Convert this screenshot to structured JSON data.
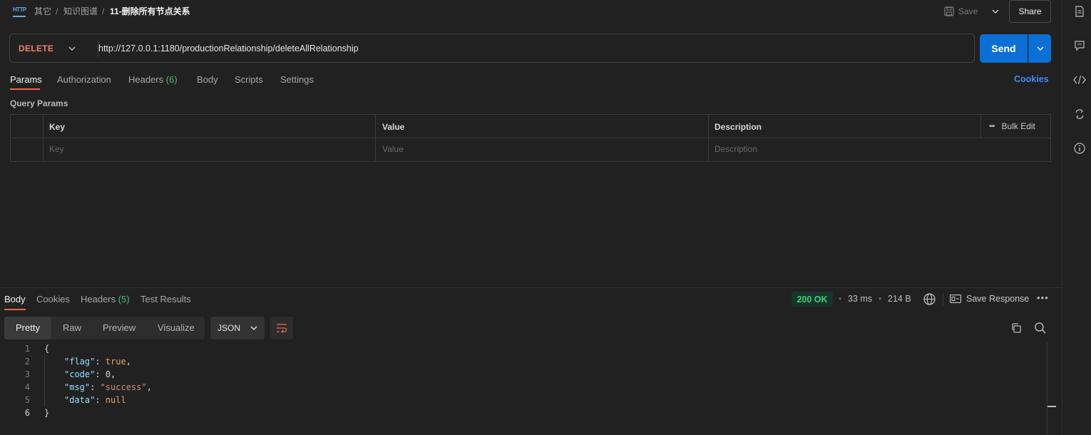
{
  "breadcrumb": {
    "icon": "http-file-icon",
    "icon_text": "HTTP",
    "parts": [
      "其它",
      "知识图谱",
      "11-删除所有节点关系"
    ],
    "separator": "/"
  },
  "header": {
    "save_label": "Save",
    "share_label": "Share"
  },
  "request": {
    "method": "DELETE",
    "method_color": "#e8836a",
    "url": "http://127.0.0.1:1180/productionRelationship/deleteAllRelationship",
    "send_label": "Send"
  },
  "request_tabs": {
    "params": "Params",
    "authorization": "Authorization",
    "headers": "Headers",
    "headers_count": "(6)",
    "body": "Body",
    "scripts": "Scripts",
    "settings": "Settings",
    "active": "Params",
    "cookies": "Cookies"
  },
  "query_params": {
    "title": "Query Params",
    "columns": [
      "Key",
      "Value",
      "Description"
    ],
    "bulk_edit": "Bulk Edit",
    "placeholders": [
      "Key",
      "Value",
      "Description"
    ]
  },
  "response_tabs": {
    "body": "Body",
    "cookies": "Cookies",
    "headers": "Headers",
    "headers_count": "(5)",
    "test_results": "Test Results",
    "active": "Body"
  },
  "response_meta": {
    "status": "200 OK",
    "status_color": "#3ccf7a",
    "time": "33 ms",
    "size": "214 B",
    "save_response": "Save Response"
  },
  "view_modes": [
    "Pretty",
    "Raw",
    "Preview",
    "Visualize"
  ],
  "active_view_mode": "Pretty",
  "format": "JSON",
  "response_body": {
    "line_numbers": [
      "1",
      "2",
      "3",
      "4",
      "5",
      "6"
    ],
    "open_brace": "{",
    "close_brace": "}",
    "fields": [
      {
        "key": "\"flag\"",
        "value": "true",
        "trail": ","
      },
      {
        "key": "\"code\"",
        "value": "0",
        "trail": ","
      },
      {
        "key": "\"msg\"",
        "value": "\"success\"",
        "trail": ","
      },
      {
        "key": "\"data\"",
        "value": "null",
        "trail": ""
      }
    ]
  },
  "side_panel_icons": [
    "document-icon",
    "comment-icon",
    "code-icon",
    "sync-icon",
    "info-icon"
  ],
  "accent_colors": {
    "send": "#0b6fd6",
    "tab_underline": "#e8684a",
    "link": "#3d8ef0"
  }
}
